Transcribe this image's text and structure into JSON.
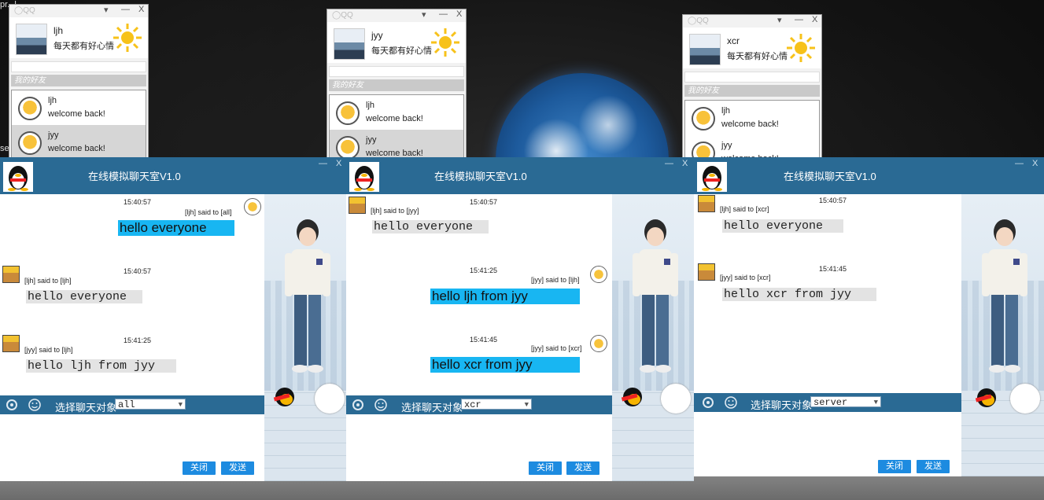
{
  "desktop": {
    "corner_text_top": "pr...l...",
    "corner_text_side": "se"
  },
  "friend_panels": [
    {
      "name": "ljh",
      "mood": "每天都有好心情",
      "group": "我的好友",
      "friends": [
        {
          "name": "ljh",
          "msg": "welcome back!"
        },
        {
          "name": "jyy",
          "msg": "welcome back!"
        }
      ]
    },
    {
      "name": "jyy",
      "mood": "每天都有好心情",
      "group": "我的好友",
      "friends": [
        {
          "name": "ljh",
          "msg": "welcome back!"
        },
        {
          "name": "jyy",
          "msg": "welcome back!"
        }
      ]
    },
    {
      "name": "xcr",
      "mood": "每天都有好心情",
      "group": "我的好友",
      "friends": [
        {
          "name": "ljh",
          "msg": "welcome back!"
        },
        {
          "name": "jyy",
          "msg": "welcome back!"
        }
      ]
    }
  ],
  "chat_windows": [
    {
      "title": "在线模拟聊天室V1.0",
      "label": "选择聊天对象",
      "target": "all",
      "close": "关闭",
      "send": "发送",
      "messages": [
        {
          "time": "15:40:57",
          "said": "[ljh] said to [all]",
          "text": "hello everyone",
          "side": "right"
        },
        {
          "time": "15:40:57",
          "said": "[ljh] said to [ljh]",
          "text": "hello everyone",
          "side": "left"
        },
        {
          "time": "15:41:25",
          "said": "[jyy] said to [ljh]",
          "text": "hello ljh from jyy",
          "side": "left"
        }
      ]
    },
    {
      "title": "在线模拟聊天室V1.0",
      "label": "选择聊天对象",
      "target": "xcr",
      "close": "关闭",
      "send": "发送",
      "messages": [
        {
          "time": "15:40:57",
          "said": "[ljh] said to [jyy]",
          "text": "hello everyone",
          "side": "left"
        },
        {
          "time": "15:41:25",
          "said": "[jyy] said to [ljh]",
          "text": "hello ljh from jyy",
          "side": "right"
        },
        {
          "time": "15:41:45",
          "said": "[jyy] said to [xcr]",
          "text": "hello xcr from jyy",
          "side": "right"
        }
      ]
    },
    {
      "title": "在线模拟聊天室V1.0",
      "label": "选择聊天对象",
      "target": "server",
      "close": "关闭",
      "send": "发送",
      "messages": [
        {
          "time": "15:40:57",
          "said": "[ljh] said to [xcr]",
          "text": "hello everyone",
          "side": "left"
        },
        {
          "time": "15:41:45",
          "said": "[jyy] said to [xcr]",
          "text": "hello xcr from jyy",
          "side": "left"
        }
      ]
    }
  ]
}
